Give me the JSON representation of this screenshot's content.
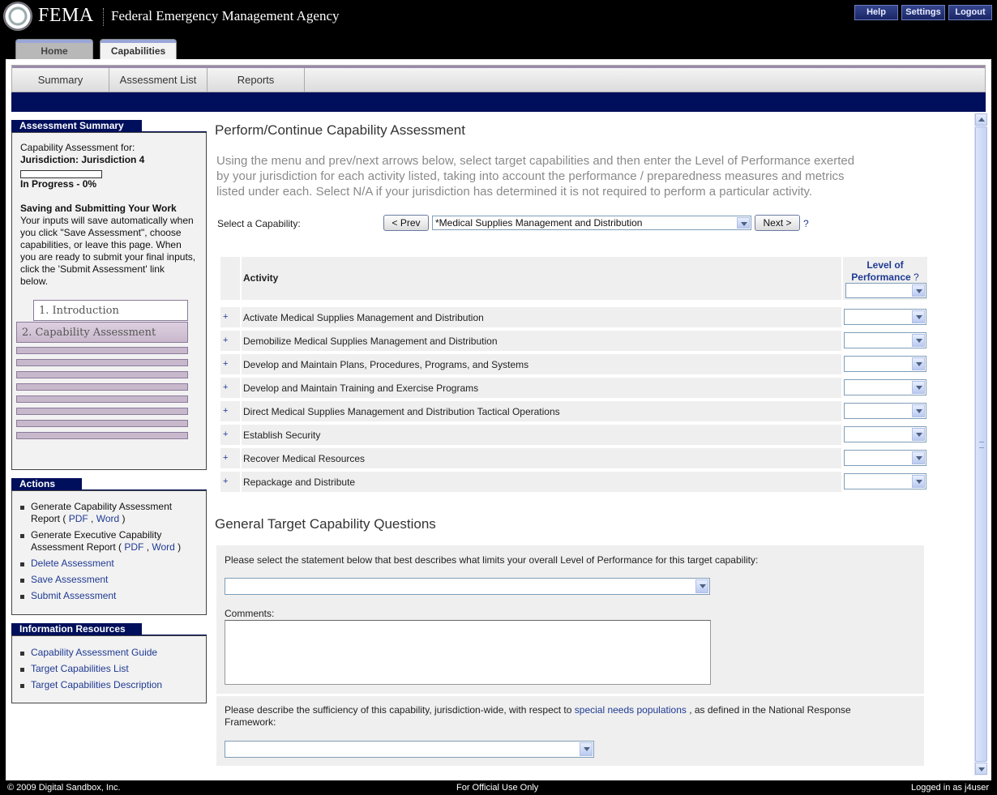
{
  "header": {
    "logo_text": "FEMA",
    "agency_name": "Federal Emergency Management Agency",
    "buttons": {
      "help": "Help",
      "settings": "Settings",
      "logout": "Logout"
    }
  },
  "main_tabs": {
    "home": "Home",
    "capabilities": "Capabilities",
    "active": "Capabilities"
  },
  "subnav": {
    "summary": "Summary",
    "assessment_list": "Assessment List",
    "reports": "Reports"
  },
  "assessment_summary": {
    "title": "Assessment Summary",
    "for_label": "Capability Assessment for:",
    "jurisdiction": "Jurisdiction: Jurisdiction 4",
    "progress_fraction": 0.0,
    "progress_text": "In Progress - 0%",
    "saving_heading": "Saving and Submitting Your Work",
    "saving_lines": [
      "Your inputs will save automatically when",
      "you click \"Save Assessment\", choose",
      "capabilities, or leave this page. When",
      "you are ready to submit your final inputs,",
      "click the 'Submit Assessment' link",
      "below."
    ],
    "steps": [
      "1. Introduction",
      "2. Capability Assessment"
    ]
  },
  "actions": {
    "title": "Actions",
    "report1": {
      "line1": "Generate Capability Assessment",
      "line2_prefix": "Report ( ",
      "pdf": "PDF",
      "sep": " , ",
      "word": "Word",
      "suffix": " )"
    },
    "report2": {
      "line1": "Generate Executive Capability",
      "line2_prefix": "Assessment Report ( ",
      "pdf": "PDF",
      "sep": " , ",
      "word": "Word",
      "suffix": " )"
    },
    "delete": "Delete Assessment",
    "save": "Save Assessment",
    "submit": "Submit Assessment"
  },
  "info_resources": {
    "title": "Information Resources",
    "links": [
      "Capability Assessment Guide",
      "Target Capabilities List",
      "Target Capabilities Description"
    ]
  },
  "main": {
    "title": "Perform/Continue Capability Assessment",
    "intro_lines": [
      "Using the menu and prev/next arrows below, select target capabilities and then enter the Level of Performance exerted",
      "by your jurisdiction for each activity listed, taking into account the performance / preparedness measures and metrics",
      "listed under each. Select N/A if your jurisdiction has determined it is not required to perform a particular activity."
    ],
    "select_label": "Select a Capability:",
    "prev_label": "< Prev",
    "next_label": "Next >",
    "help_mark": "?",
    "selected_capability": "*Medical Supplies Management and Distribution"
  },
  "activity_table": {
    "col_activity": "Activity",
    "col_level_line1": "Level of",
    "col_level_line2": "Performance",
    "col_help": "?",
    "expand_symbol": "+",
    "rows": [
      "Activate Medical Supplies Management and Distribution",
      "Demobilize Medical Supplies Management and Distribution",
      "Develop and Maintain Plans, Procedures, Programs, and Systems",
      "Develop and Maintain Training and Exercise Programs",
      "Direct Medical Supplies Management and Distribution Tactical Operations",
      "Establish Security",
      "Recover Medical Resources",
      "Repackage and Distribute"
    ]
  },
  "questions": {
    "title": "General Target Capability Questions",
    "q1": "Please select the statement below that best describes what limits your overall Level of Performance for this target capability:",
    "comments_label": "Comments:",
    "q2_prefix": "Please describe the sufficiency of this capability, jurisdiction-wide, with respect to ",
    "q2_link": "special needs populations",
    "q2_suffix": " , as defined in the National Response",
    "q2_line2": "Framework:"
  },
  "footer": {
    "copyright": "© 2009 Digital Sandbox, Inc.",
    "classification": "For Official Use Only",
    "logged_in": "Logged in as j4user"
  },
  "colors": {
    "navy": "#000f5c",
    "link": "#1f3a93",
    "panel_bg": "#f2f2f2",
    "step_purple": "#c9b8cc"
  }
}
